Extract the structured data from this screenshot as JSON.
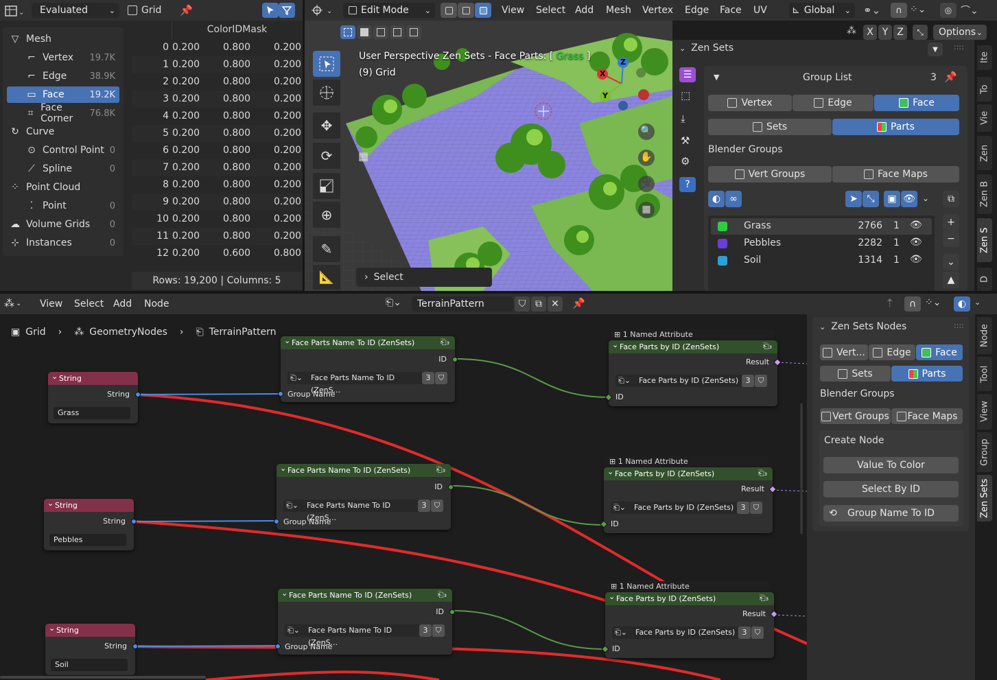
{
  "spreadsheet": {
    "mode": "Evaluated",
    "object": "Grid",
    "column_header": "ColorIDMask",
    "tree": [
      {
        "label": "Mesh",
        "count": "",
        "icon": "mesh-icon"
      },
      {
        "label": "Vertex",
        "count": "19.7K",
        "icon": "vertex-icon"
      },
      {
        "label": "Edge",
        "count": "38.9K",
        "icon": "edge-icon"
      },
      {
        "label": "Face",
        "count": "19.2K",
        "icon": "face-icon"
      },
      {
        "label": "Face Corner",
        "count": "76.8K",
        "icon": "face-corner-icon"
      },
      {
        "label": "Curve",
        "count": "",
        "icon": "curve-icon"
      },
      {
        "label": "Control Point",
        "count": "0",
        "icon": "control-point-icon"
      },
      {
        "label": "Spline",
        "count": "0",
        "icon": "spline-icon"
      },
      {
        "label": "Point Cloud",
        "count": "",
        "icon": "point-cloud-icon"
      },
      {
        "label": "Point",
        "count": "0",
        "icon": "point-icon"
      },
      {
        "label": "Volume Grids",
        "count": "0",
        "icon": "volume-icon"
      },
      {
        "label": "Instances",
        "count": "0",
        "icon": "instances-icon"
      }
    ],
    "rows": [
      [
        "0",
        "0.200",
        "0.800",
        "0.200"
      ],
      [
        "1",
        "0.200",
        "0.800",
        "0.200"
      ],
      [
        "2",
        "0.200",
        "0.800",
        "0.200"
      ],
      [
        "3",
        "0.200",
        "0.800",
        "0.200"
      ],
      [
        "4",
        "0.200",
        "0.800",
        "0.200"
      ],
      [
        "5",
        "0.200",
        "0.800",
        "0.200"
      ],
      [
        "6",
        "0.200",
        "0.800",
        "0.200"
      ],
      [
        "7",
        "0.200",
        "0.800",
        "0.200"
      ],
      [
        "8",
        "0.200",
        "0.800",
        "0.200"
      ],
      [
        "9",
        "0.200",
        "0.800",
        "0.200"
      ],
      [
        "10",
        "0.200",
        "0.800",
        "0.200"
      ],
      [
        "11",
        "0.200",
        "0.800",
        "0.200"
      ],
      [
        "12",
        "0.200",
        "0.600",
        "0.800"
      ]
    ],
    "footer": "Rows: 19,200   |   Columns: 5"
  },
  "viewport": {
    "mode": "Edit Mode",
    "menus": [
      "View",
      "Select",
      "Add",
      "Mesh",
      "Vertex",
      "Edge",
      "Face",
      "UV"
    ],
    "orientation": "Global",
    "options": "Options",
    "title": "User Perspective Zen Sets - Face Parts: [",
    "title_group": "Grass",
    "title_end": "]",
    "subtitle": "(9) Grid",
    "last_op": "Select",
    "gizmo": {
      "x": "X",
      "y": "Y",
      "z": "Z"
    }
  },
  "zen_panel": {
    "title": "Zen Sets",
    "group_list": "Group List",
    "group_count": "3",
    "modes": [
      "Vertex",
      "Edge",
      "Face"
    ],
    "set_modes": [
      "Sets",
      "Parts"
    ],
    "blender_groups": "Blender Groups",
    "vert_groups": "Vert Groups",
    "face_maps": "Face Maps",
    "groups": [
      {
        "name": "Grass",
        "count": "2766",
        "n": "1",
        "color": "#2ecc40"
      },
      {
        "name": "Pebbles",
        "count": "2282",
        "n": "1",
        "color": "#6a3fd6"
      },
      {
        "name": "Soil",
        "count": "1314",
        "n": "1",
        "color": "#2ea0d8"
      }
    ],
    "side_tabs": [
      "Ite",
      "To",
      "Vie",
      "Zen",
      "Zen B",
      "Zen S",
      "D"
    ]
  },
  "node_editor": {
    "menus": [
      "View",
      "Select",
      "Add",
      "Node"
    ],
    "tree_name": "TerrainPattern",
    "breadcrumb": [
      "Grid",
      "GeometryNodes",
      "TerrainPattern"
    ],
    "string_node_title": "String",
    "string_socket": "String",
    "strings": [
      "Grass",
      "Pebbles",
      "Soil"
    ],
    "name_to_id_title": "Face Parts Name To ID (ZenSets)",
    "name_to_id_field": "Face Parts Name To ID (ZenS...",
    "id_label": "ID",
    "group_name_label": "Group Name",
    "users": "3",
    "named_attr_label": "1 Named Attribute",
    "by_id_title": "Face Parts by ID (ZenSets)",
    "by_id_field": "Face Parts by ID (ZenSets)",
    "result_label": "Result"
  },
  "zen_nodes_panel": {
    "title": "Zen Sets Nodes",
    "modes": [
      "Vert...",
      "Edge",
      "Face"
    ],
    "set_modes": [
      "Sets",
      "Parts"
    ],
    "blender_groups": "Blender Groups",
    "vert_groups": "Vert Groups",
    "face_maps": "Face Maps",
    "create_node": "Create Node",
    "buttons": [
      "Value To Color",
      "Select By ID",
      "Group Name To ID"
    ],
    "side_tabs": [
      "Node",
      "Tool",
      "View",
      "Group",
      "Zen Sets"
    ]
  }
}
